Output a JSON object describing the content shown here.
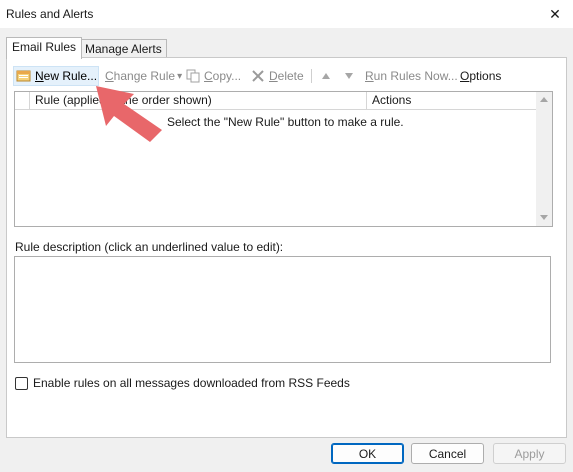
{
  "window": {
    "title": "Rules and Alerts",
    "close_glyph": "✕"
  },
  "tabs": [
    {
      "label": "Email Rules"
    },
    {
      "label": "Manage Alerts"
    }
  ],
  "toolbar": {
    "new_rule": {
      "first": "N",
      "rest": "ew Rule..."
    },
    "change_rule": {
      "first": "C",
      "rest": "hange Rule",
      "caret": "▾"
    },
    "copy": {
      "first": "C",
      "rest": "opy..."
    },
    "delete": {
      "first": "D",
      "rest": "elete"
    },
    "run_rules": {
      "first": "R",
      "rest": "un Rules Now..."
    },
    "options": {
      "first": "O",
      "rest": "ptions"
    }
  },
  "rules_list": {
    "columns": [
      {
        "label": "Rule (applied in the order shown)"
      },
      {
        "label": "Actions"
      }
    ],
    "empty_message": "Select the \"New Rule\" button to make a rule."
  },
  "description": {
    "label": "Rule description (click an underlined value to edit):"
  },
  "rss": {
    "label": "Enable rules on all messages downloaded from RSS Feeds",
    "checked": false
  },
  "buttons": {
    "ok": "OK",
    "cancel": "Cancel",
    "apply": "Apply"
  },
  "colors": {
    "accent": "#0067c0",
    "highlight": "#e5f1fb",
    "overlay_arrow": "#e8676a"
  }
}
